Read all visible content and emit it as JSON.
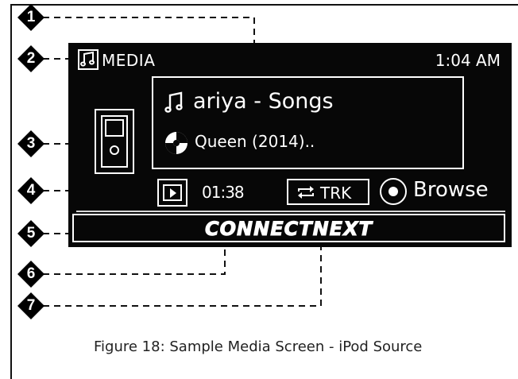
{
  "callouts": [
    "1",
    "2",
    "3",
    "4",
    "5",
    "6",
    "7"
  ],
  "screen": {
    "header": {
      "title": "MEDIA",
      "time": "1:04 AM",
      "icon": "music-note-icon"
    },
    "now_playing": {
      "song": "ariya - Songs",
      "album": "Queen (2014)..",
      "song_icon": "music-note-icon",
      "album_icon": "disc-icon"
    },
    "source_icon": "ipod-icon",
    "controls": {
      "play_icon": "play-icon",
      "elapsed": "01:38",
      "repeat_icon": "repeat-icon",
      "repeat_label": "TRK",
      "browse_icon": "knob-icon",
      "browse_label": "Browse"
    },
    "logo": "CONNECTNEXT"
  },
  "caption": "Figure 18: Sample Media Screen - iPod Source",
  "colors": {
    "screen_bg": "#070707",
    "foreground": "#ffffff",
    "callout": "#000000"
  }
}
